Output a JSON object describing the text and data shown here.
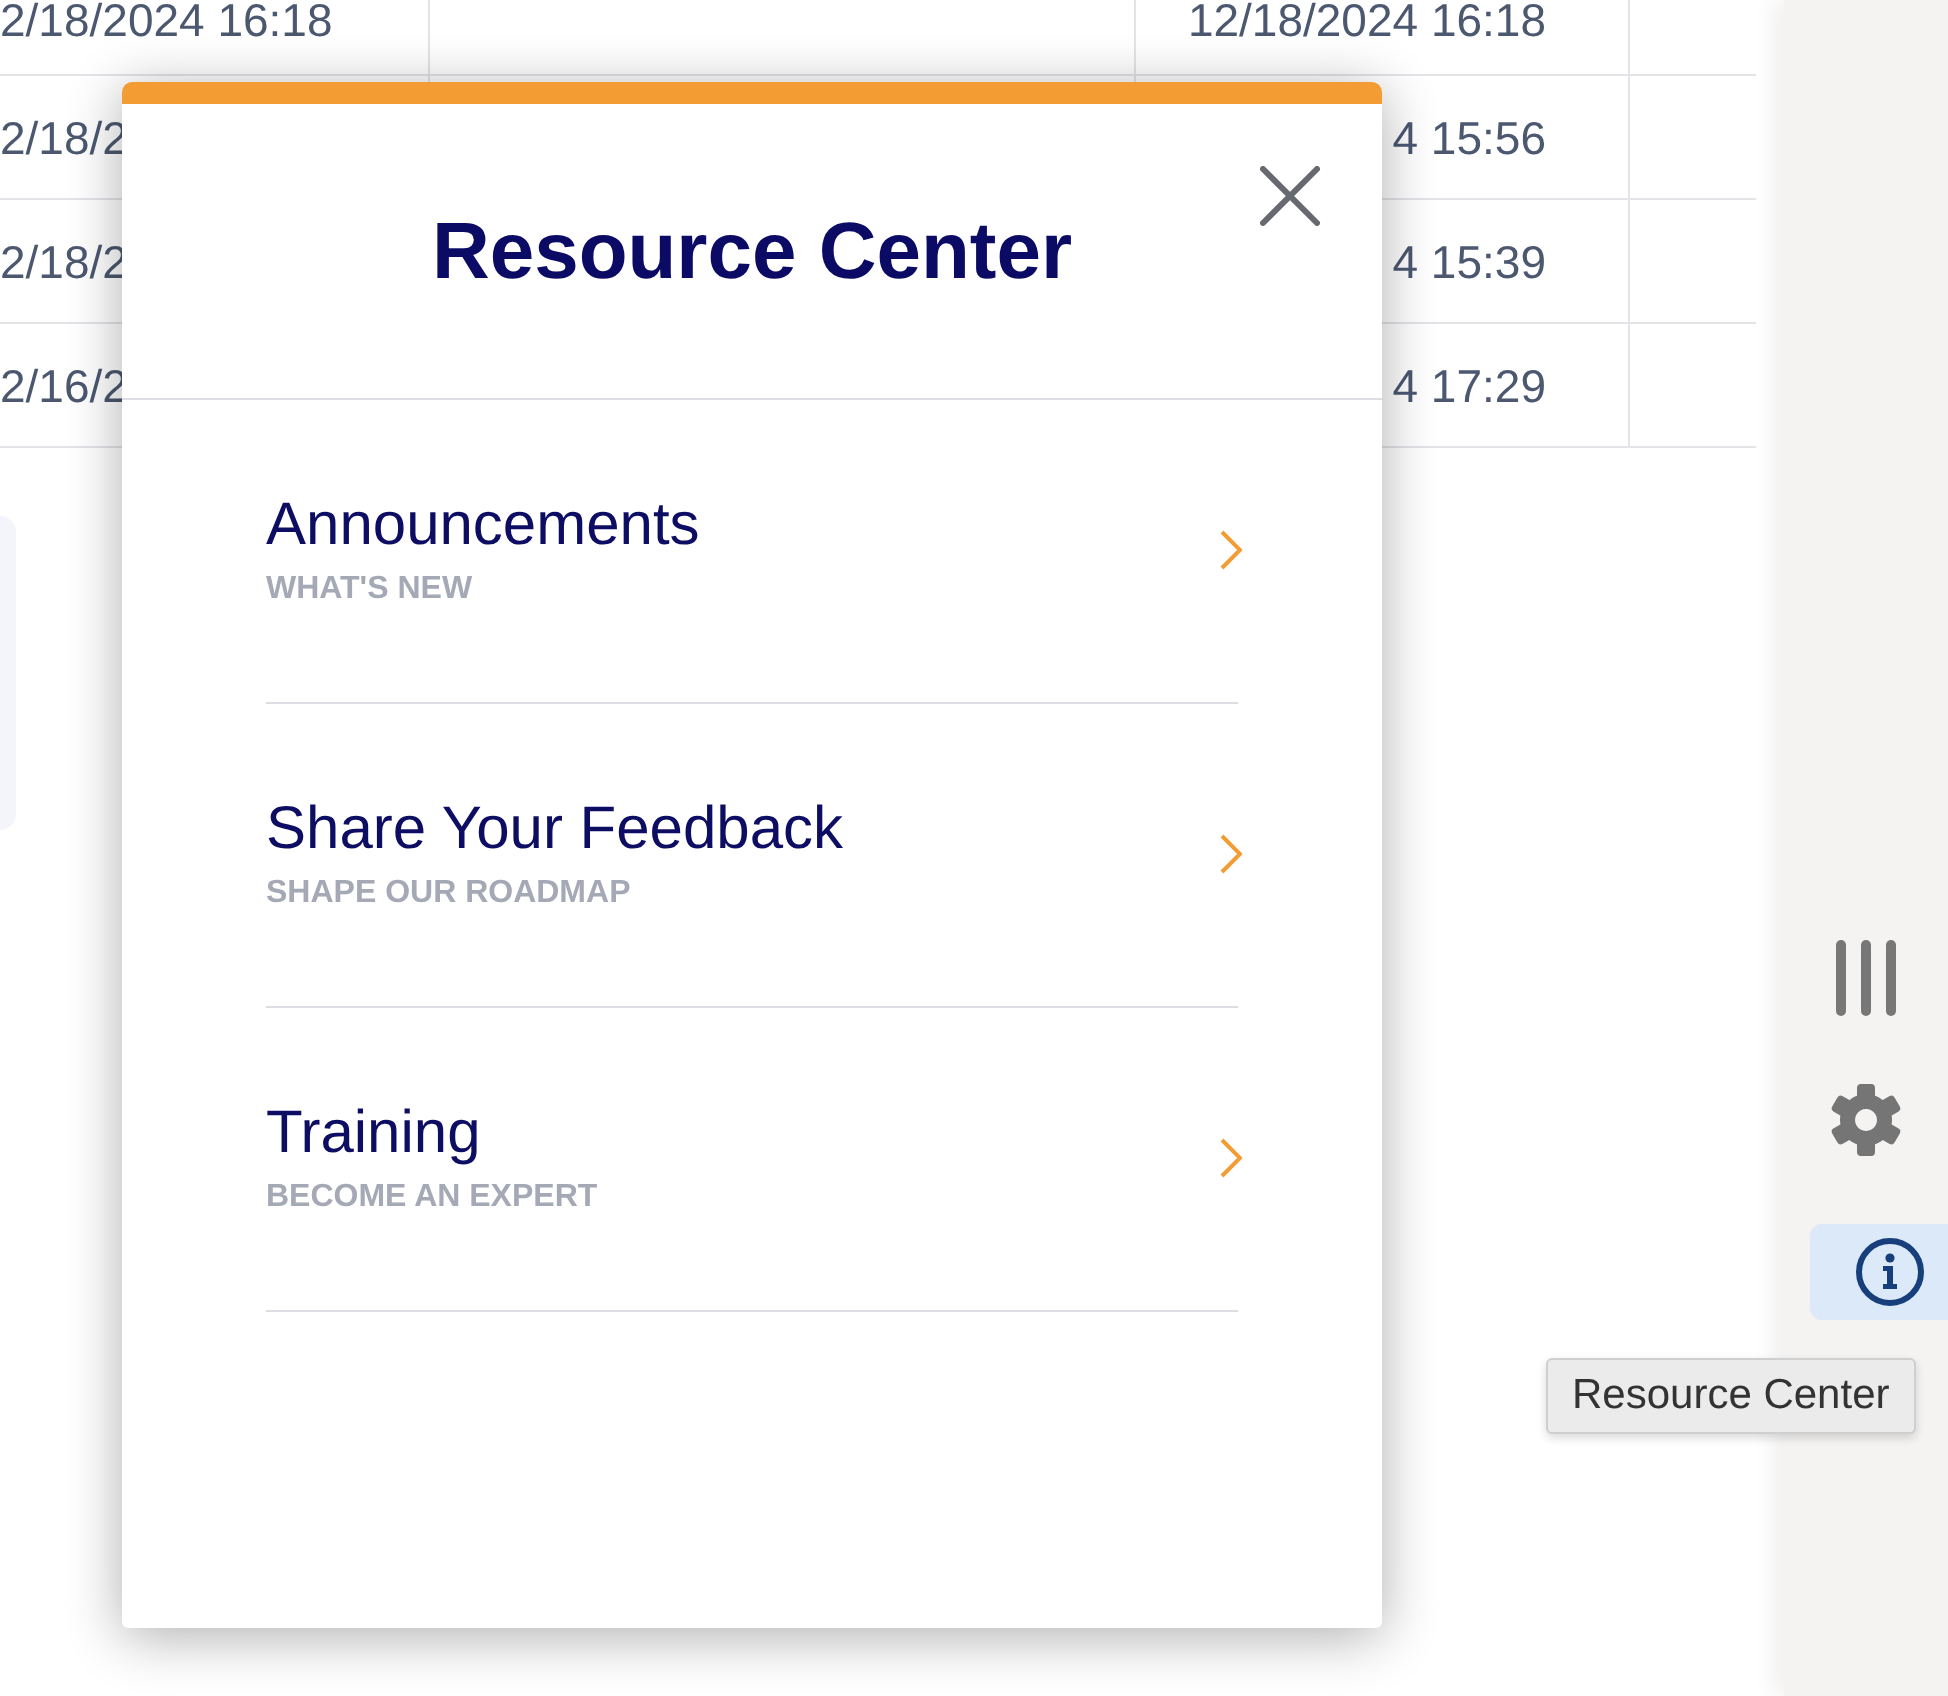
{
  "table": {
    "rows": [
      {
        "column_1": "2/18/2024 16:18",
        "column_3": "12/18/2024 16:18"
      },
      {
        "column_1": "2/18/2",
        "column_3": "4 15:56"
      },
      {
        "column_1": "2/18/2",
        "column_3": "4 15:39"
      },
      {
        "column_1": "2/16/2",
        "column_3": "4 17:29"
      }
    ]
  },
  "resource_center": {
    "title": "Resource Center",
    "items": [
      {
        "title": "Announcements",
        "subtitle": "WHAT'S NEW"
      },
      {
        "title": "Share Your Feedback",
        "subtitle": "SHAPE OUR ROADMAP"
      },
      {
        "title": "Training",
        "subtitle": "BECOME AN EXPERT"
      }
    ]
  },
  "sidebar": {
    "items": [
      {
        "kind": "columns",
        "selected": false
      },
      {
        "kind": "settings",
        "selected": false
      },
      {
        "kind": "info",
        "selected": true
      }
    ]
  },
  "tooltip": {
    "text": "Resource Center"
  }
}
